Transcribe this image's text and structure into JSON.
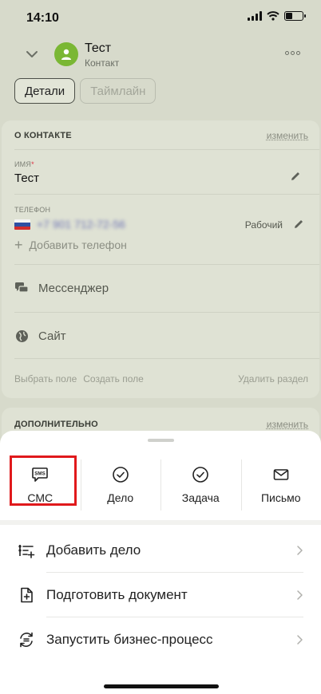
{
  "status_bar": {
    "time": "14:10"
  },
  "header": {
    "title": "Тест",
    "subtitle": "Контакт"
  },
  "tabs": [
    {
      "label": "Детали",
      "active": true
    },
    {
      "label": "Таймлайн",
      "active": false
    }
  ],
  "contact_section": {
    "title": "О КОНТАКТЕ",
    "edit_label": "изменить",
    "name_label": "ИМЯ",
    "name_required_mark": "*",
    "name_value": "Тест",
    "phone_label": "ТЕЛЕФОН",
    "phone_value": "+7 901 712-72-56",
    "phone_type": "Рабочий",
    "add_phone_label": "Добавить телефон",
    "messenger_label": "Мессенджер",
    "site_label": "Сайт",
    "footer": {
      "select_field": "Выбрать поле",
      "create_field": "Создать поле",
      "delete_section": "Удалить раздел"
    }
  },
  "extra_section": {
    "title": "ДОПОЛНИТЕЛЬНО",
    "edit_label": "изменить"
  },
  "sheet": {
    "actions": [
      {
        "label": "СМС",
        "icon": "sms-icon"
      },
      {
        "label": "Дело",
        "icon": "check-circle-icon"
      },
      {
        "label": "Задача",
        "icon": "check-circle-icon"
      },
      {
        "label": "Письмо",
        "icon": "envelope-icon"
      }
    ],
    "menu": [
      {
        "label": "Добавить дело",
        "icon": "add-activity-icon"
      },
      {
        "label": "Подготовить документ",
        "icon": "document-add-icon"
      },
      {
        "label": "Запустить бизнес-процесс",
        "icon": "business-process-icon"
      }
    ]
  },
  "colors": {
    "avatar": "#7ab734",
    "highlight_frame": "#e0191c",
    "overlay_background": "#d7dacb"
  }
}
